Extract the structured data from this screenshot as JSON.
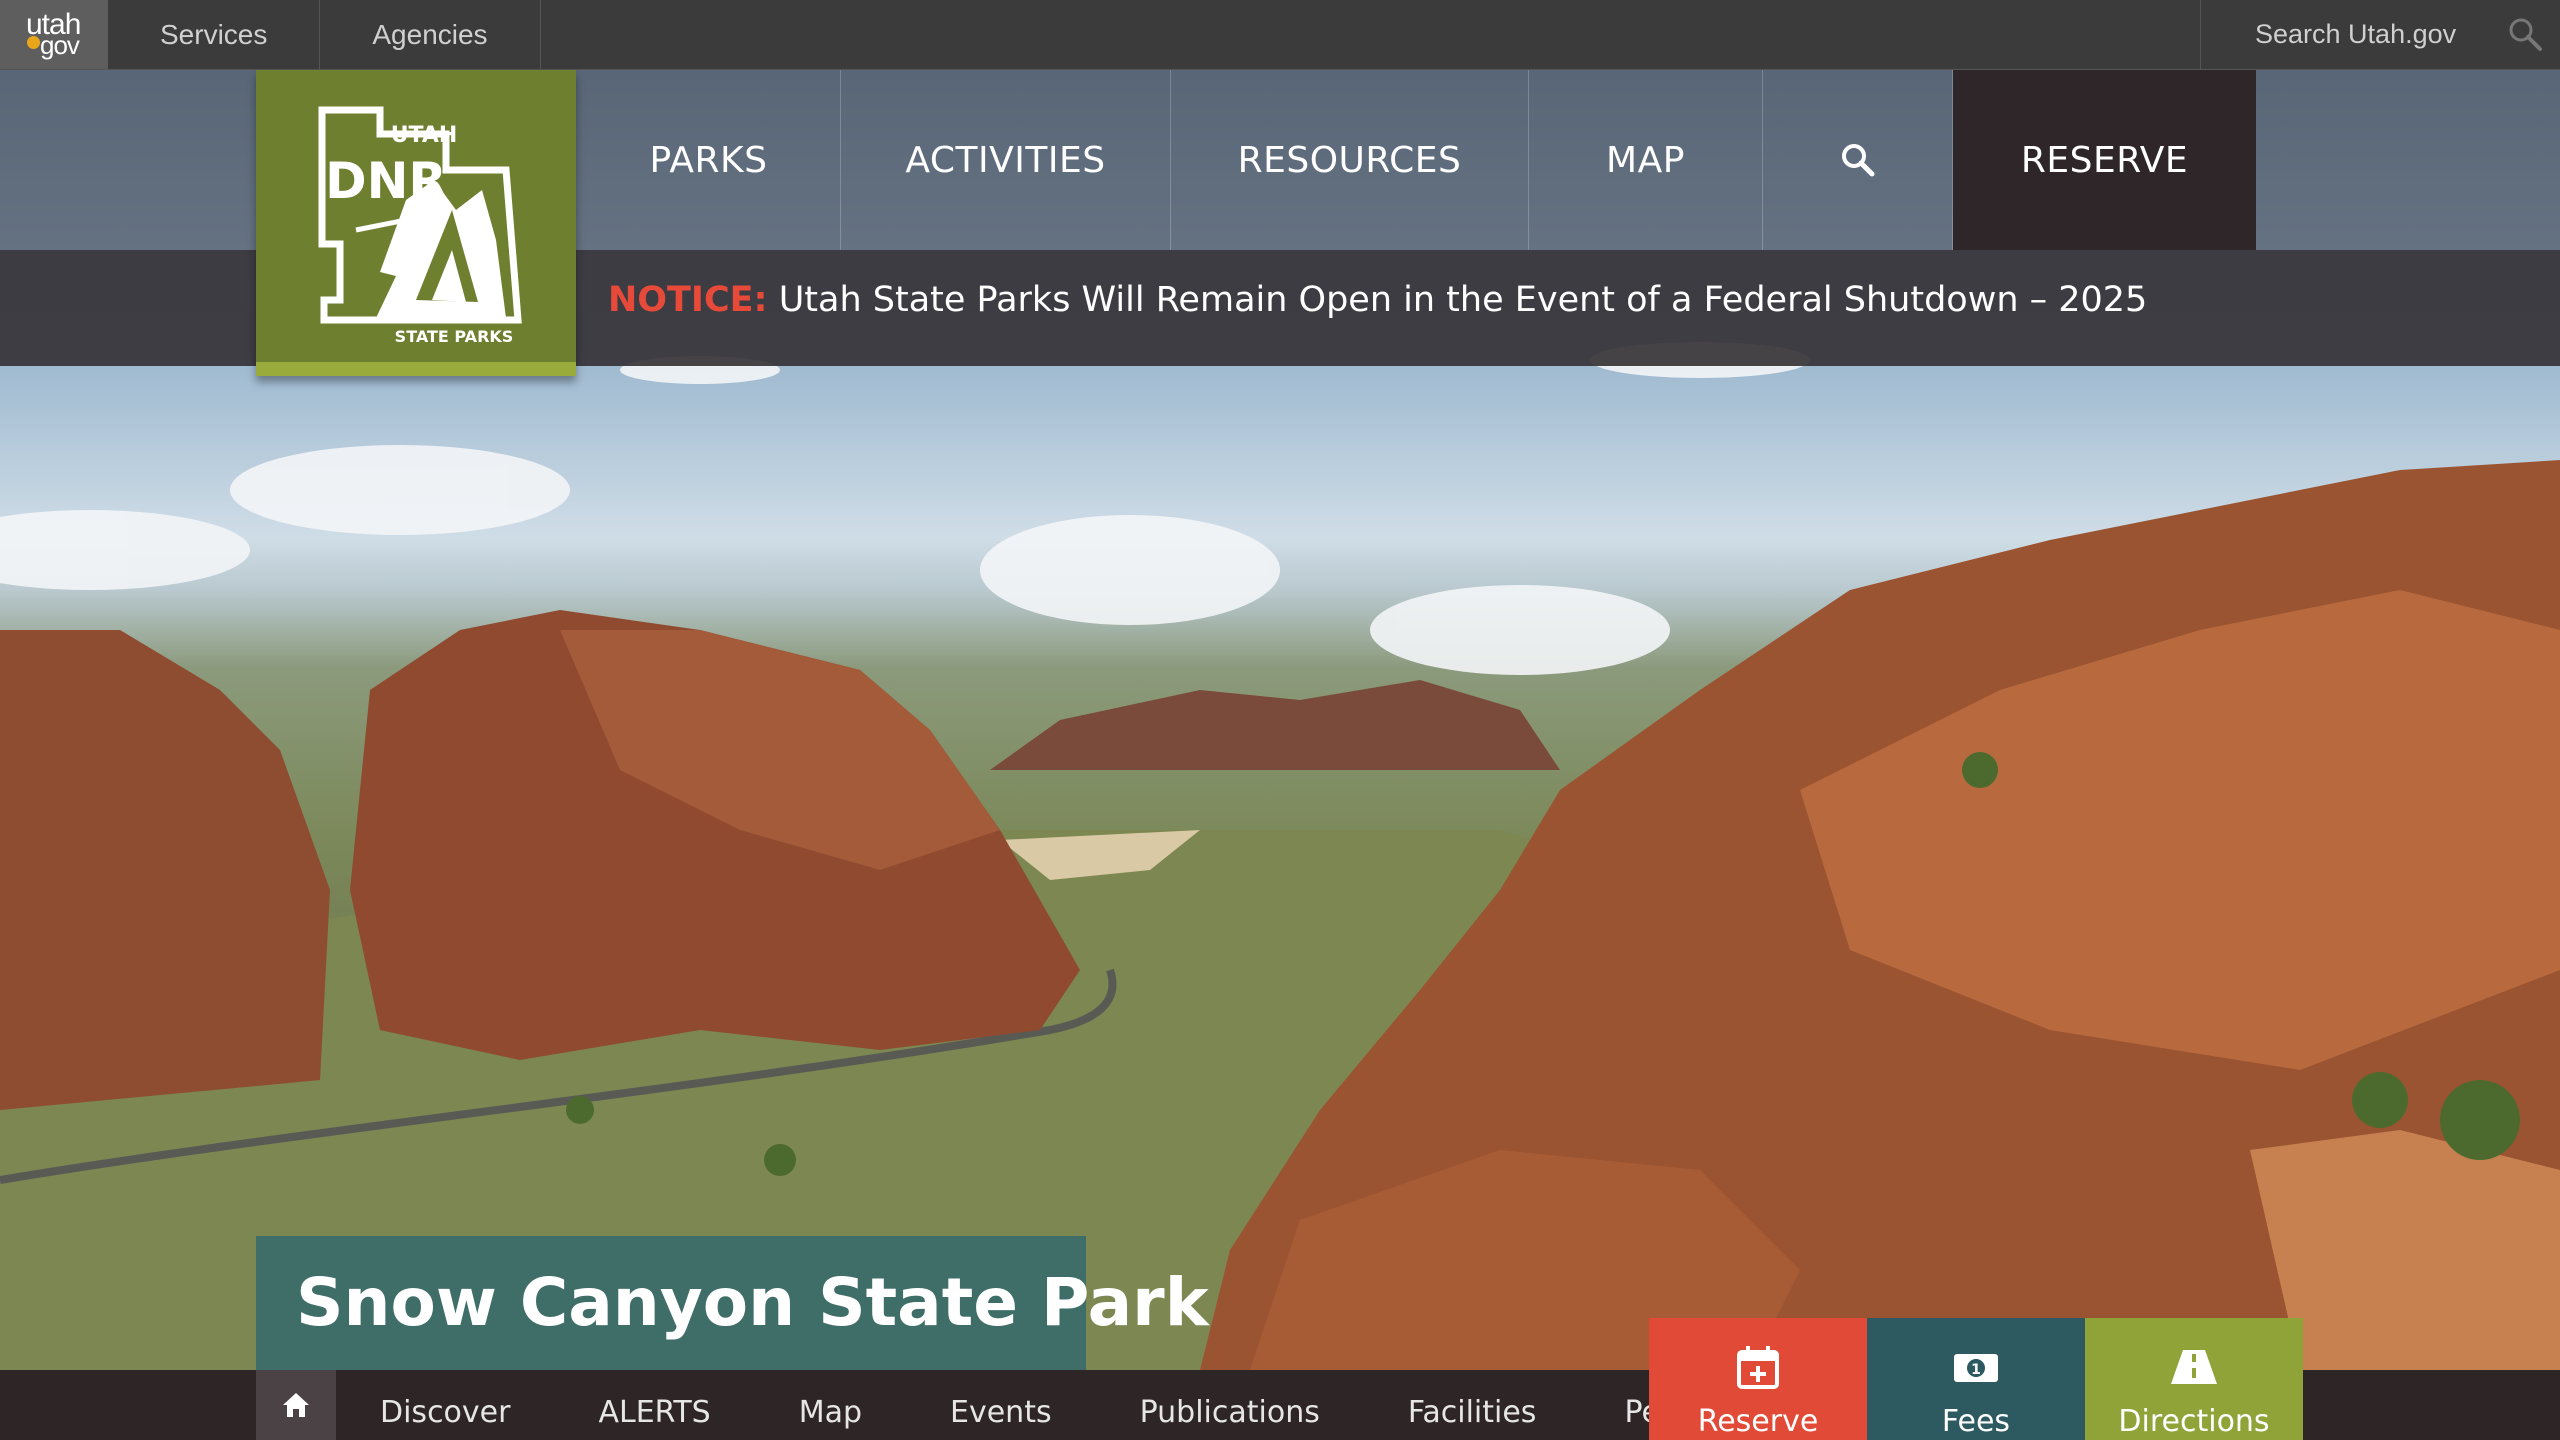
{
  "topbar": {
    "logo_top": "utah",
    "logo_bottom": "gov",
    "items": [
      "Services",
      "Agencies"
    ],
    "search_placeholder": "Search Utah.gov"
  },
  "logo": {
    "state": "UTAH",
    "agency": "DNR",
    "division": "STATE PARKS"
  },
  "main_nav": {
    "items": [
      "PARKS",
      "ACTIVITIES",
      "RESOURCES",
      "MAP"
    ],
    "reserve": "RESERVE"
  },
  "notice": {
    "label": "NOTICE:",
    "text": "Utah State Parks Will Remain Open in the Event of a Federal Shutdown – 2025"
  },
  "park": {
    "title": "Snow Canyon State Park"
  },
  "park_nav": {
    "items": [
      "Discover",
      "ALERTS",
      "Map",
      "Events",
      "Publications",
      "Facilities",
      "Permits"
    ]
  },
  "actions": {
    "reserve": "Reserve",
    "fees": "Fees",
    "directions": "Directions"
  },
  "colors": {
    "logo_green": "#6e7f30",
    "notice_red": "#e84a3a",
    "reserve_tile": "#e14a37",
    "fees_tile": "#2c5a60",
    "directions_tile": "#8fa338"
  },
  "icons": {
    "top_search": "search-icon",
    "nav_search": "search-icon",
    "home": "home-icon",
    "reserve": "calendar-plus-icon",
    "fees": "money-icon",
    "directions": "road-icon"
  }
}
